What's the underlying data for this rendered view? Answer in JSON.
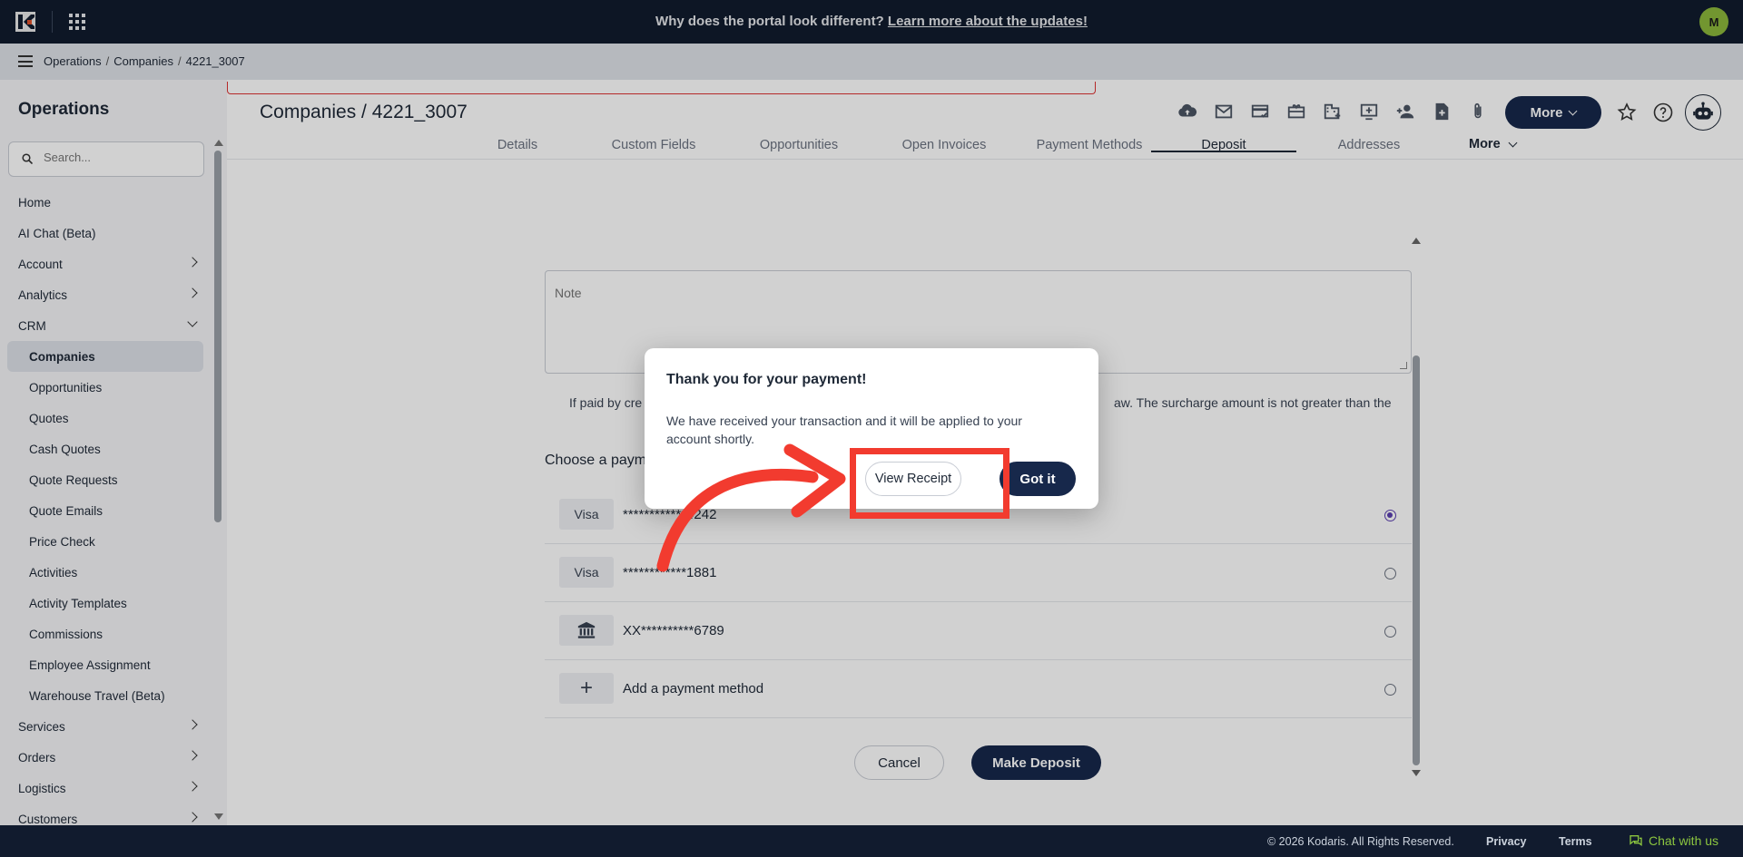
{
  "topbar": {
    "announcement_prefix": "Why does the portal look different?",
    "announcement_link": "Learn more about the updates!",
    "avatar_initial": "M"
  },
  "breadcrumb": [
    "Operations",
    "Companies",
    "4221_3007"
  ],
  "sidebar": {
    "title": "Operations",
    "search_placeholder": "Search...",
    "items": [
      {
        "label": "Home",
        "type": "top"
      },
      {
        "label": "AI Chat (Beta)",
        "type": "top"
      },
      {
        "label": "Account",
        "type": "top",
        "chevron": "right"
      },
      {
        "label": "Analytics",
        "type": "top",
        "chevron": "right"
      },
      {
        "label": "CRM",
        "type": "top",
        "chevron": "down"
      },
      {
        "label": "Companies",
        "type": "sub",
        "active": true
      },
      {
        "label": "Opportunities",
        "type": "sub"
      },
      {
        "label": "Quotes",
        "type": "sub"
      },
      {
        "label": "Cash Quotes",
        "type": "sub"
      },
      {
        "label": "Quote Requests",
        "type": "sub"
      },
      {
        "label": "Quote Emails",
        "type": "sub"
      },
      {
        "label": "Price Check",
        "type": "sub"
      },
      {
        "label": "Activities",
        "type": "sub"
      },
      {
        "label": "Activity Templates",
        "type": "sub"
      },
      {
        "label": "Commissions",
        "type": "sub"
      },
      {
        "label": "Employee Assignment",
        "type": "sub"
      },
      {
        "label": "Warehouse Travel (Beta)",
        "type": "sub"
      },
      {
        "label": "Services",
        "type": "top",
        "chevron": "right"
      },
      {
        "label": "Orders",
        "type": "top",
        "chevron": "right"
      },
      {
        "label": "Logistics",
        "type": "top",
        "chevron": "right"
      },
      {
        "label": "Customers",
        "type": "top",
        "chevron": "right"
      }
    ]
  },
  "header": {
    "title": "Companies / 4221_3007",
    "more_label": "More"
  },
  "tabs": [
    {
      "label": "Details"
    },
    {
      "label": "Custom Fields"
    },
    {
      "label": "Opportunities"
    },
    {
      "label": "Open Invoices"
    },
    {
      "label": "Payment Methods"
    },
    {
      "label": "Deposit",
      "active": true
    },
    {
      "label": "Addresses"
    }
  ],
  "tab_more": "More",
  "form": {
    "note_placeholder": "Note",
    "surcharge_left": "If paid by cre",
    "surcharge_right": "aw. The surcharge amount is not greater than the",
    "choose_label": "Choose a paym",
    "payment_methods": [
      {
        "badge": "Visa",
        "text": "************4242",
        "selected": true
      },
      {
        "badge": "Visa",
        "text": "************1881",
        "selected": false
      },
      {
        "badge": "bank-icon",
        "text": "XX**********6789",
        "selected": false
      },
      {
        "badge": "plus-icon",
        "text": "Add a payment method",
        "selected": false
      }
    ],
    "cancel_label": "Cancel",
    "deposit_label": "Make Deposit"
  },
  "dialog": {
    "title": "Thank you for your payment!",
    "message": "We have received your transaction and it will be applied to your account shortly.",
    "receipt_label": "View Receipt",
    "gotit_label": "Got it"
  },
  "footer": {
    "copyright": "© 2026 Kodaris. All Rights Reserved.",
    "privacy": "Privacy",
    "terms": "Terms",
    "chat": "Chat with us"
  },
  "colors": {
    "navy": "#17284b",
    "topbar": "#111b2e",
    "highlight": "#f23b2f",
    "chat_green": "#8cc63f"
  }
}
